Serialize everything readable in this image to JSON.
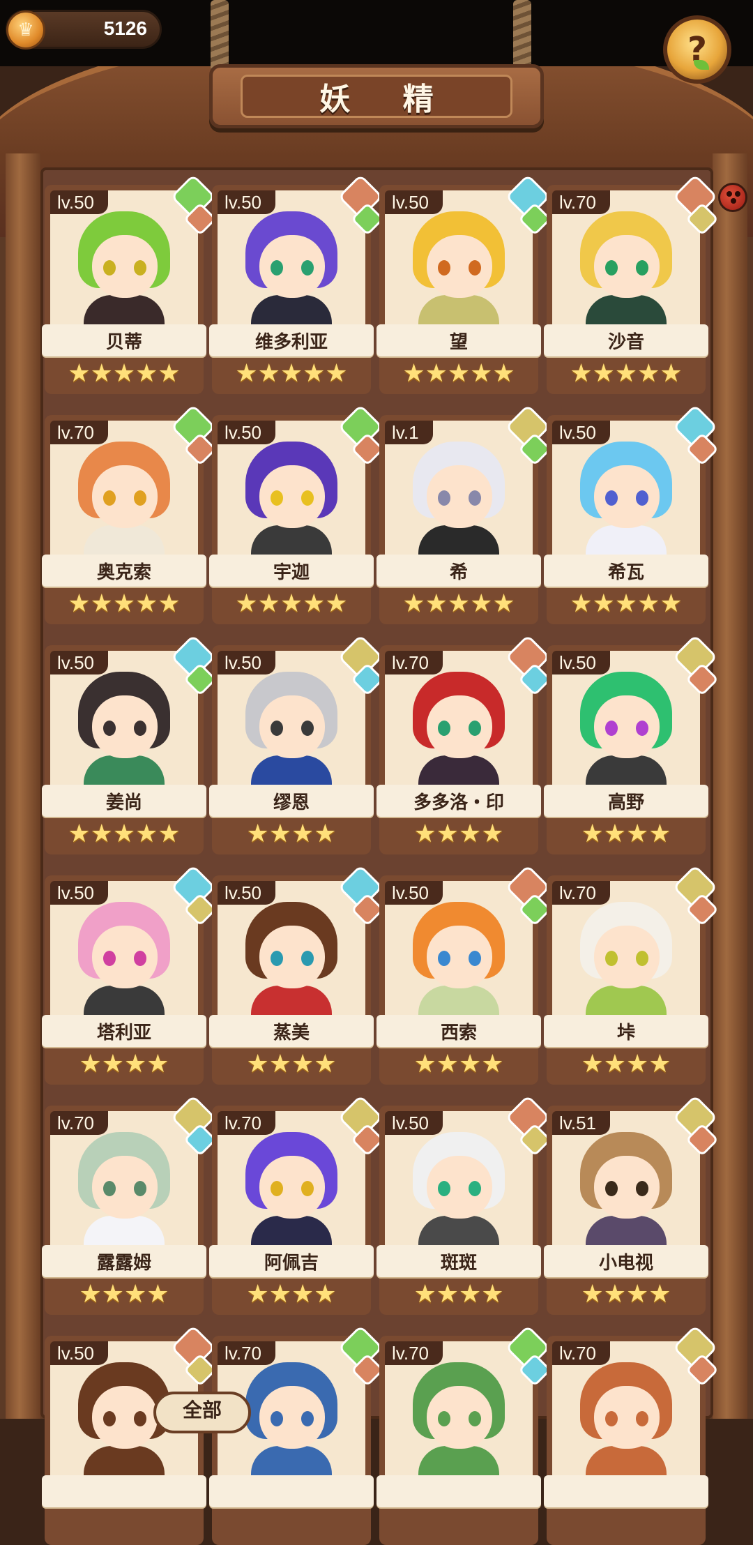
{
  "header": {
    "currency_amount": "5126",
    "title": "妖 精",
    "help_symbol": "?"
  },
  "colors": {
    "green": "#7ccf5a",
    "blue": "#6ccfe0",
    "copper": "#d88460",
    "gold": "#d6c46a"
  },
  "fairies": [
    {
      "level": "lv.50",
      "name": "贝蒂",
      "stars": "★★★★★",
      "hair": "#7ecb3c",
      "body": "#3a2a2a",
      "eye": "#c9b020",
      "elem1": "green",
      "elem2": "copper"
    },
    {
      "level": "lv.50",
      "name": "维多利亚",
      "stars": "★★★★★",
      "hair": "#6a4ad0",
      "body": "#2a2a3a",
      "eye": "#2aa070",
      "elem1": "copper",
      "elem2": "green"
    },
    {
      "level": "lv.50",
      "name": "望",
      "stars": "★★★★★",
      "hair": "#f2c036",
      "body": "#c8c070",
      "eye": "#d06a20",
      "elem1": "blue",
      "elem2": "green"
    },
    {
      "level": "lv.70",
      "name": "沙音",
      "stars": "★★★★★",
      "hair": "#f0c84a",
      "body": "#2a4a3a",
      "eye": "#28a060",
      "elem1": "copper",
      "elem2": "gold"
    },
    {
      "level": "lv.70",
      "name": "奥克索",
      "stars": "★★★★★",
      "hair": "#e8884a",
      "body": "#f0e8d8",
      "eye": "#e0a020",
      "elem1": "green",
      "elem2": "copper"
    },
    {
      "level": "lv.50",
      "name": "宇迦",
      "stars": "★★★★★",
      "hair": "#5a38b8",
      "body": "#3a3a3a",
      "eye": "#e8c020",
      "elem1": "green",
      "elem2": "copper"
    },
    {
      "level": "lv.1",
      "name": "希",
      "stars": "★★★★★",
      "hair": "#e8e8f0",
      "body": "#2a2a2a",
      "eye": "#8888aa",
      "elem1": "gold",
      "elem2": "green"
    },
    {
      "level": "lv.50",
      "name": "希瓦",
      "stars": "★★★★★",
      "hair": "#6cc8f0",
      "body": "#f0f0f8",
      "eye": "#5060d0",
      "elem1": "blue",
      "elem2": "copper"
    },
    {
      "level": "lv.50",
      "name": "姜尚",
      "stars": "★★★★★",
      "hair": "#3a3030",
      "body": "#3a8a5a",
      "eye": "#3a3030",
      "elem1": "blue",
      "elem2": "green"
    },
    {
      "level": "lv.50",
      "name": "缪恩",
      "stars": "★★★★",
      "hair": "#c8c8cc",
      "body": "#2a4aa0",
      "eye": "#3a3a3a",
      "elem1": "gold",
      "elem2": "blue"
    },
    {
      "level": "lv.70",
      "name": "多多洛・印",
      "stars": "★★★★",
      "hair": "#c82a2a",
      "body": "#3a2a3a",
      "eye": "#2aa070",
      "elem1": "copper",
      "elem2": "blue"
    },
    {
      "level": "lv.50",
      "name": "高野",
      "stars": "★★★★",
      "hair": "#2ec070",
      "body": "#3a3a3a",
      "eye": "#b040d0",
      "elem1": "gold",
      "elem2": "copper"
    },
    {
      "level": "lv.50",
      "name": "塔利亚",
      "stars": "★★★★",
      "hair": "#f0a0c8",
      "body": "#3a3a3a",
      "eye": "#d040a0",
      "elem1": "blue",
      "elem2": "gold"
    },
    {
      "level": "lv.50",
      "name": "蒸美",
      "stars": "★★★★",
      "hair": "#6a3a20",
      "body": "#c83030",
      "eye": "#2a9ab0",
      "elem1": "blue",
      "elem2": "copper"
    },
    {
      "level": "lv.50",
      "name": "西索",
      "stars": "★★★★",
      "hair": "#f08a30",
      "body": "#c8d8a0",
      "eye": "#3a88d0",
      "elem1": "copper",
      "elem2": "green"
    },
    {
      "level": "lv.70",
      "name": "垰",
      "stars": "★★★★",
      "hair": "#f4f0e8",
      "body": "#a0c850",
      "eye": "#c0c030",
      "elem1": "gold",
      "elem2": "copper"
    },
    {
      "level": "lv.70",
      "name": "露露姆",
      "stars": "★★★★",
      "hair": "#b8d0b8",
      "body": "#f4f4f8",
      "eye": "#5a8a6a",
      "elem1": "gold",
      "elem2": "blue"
    },
    {
      "level": "lv.70",
      "name": "阿佩吉",
      "stars": "★★★★",
      "hair": "#6a48d8",
      "body": "#2a2a4a",
      "eye": "#e0b020",
      "elem1": "gold",
      "elem2": "copper"
    },
    {
      "level": "lv.50",
      "name": "斑斑",
      "stars": "★★★★",
      "hair": "#f0f0f0",
      "body": "#4a4a4a",
      "eye": "#2ab080",
      "elem1": "copper",
      "elem2": "gold"
    },
    {
      "level": "lv.51",
      "name": "小电视",
      "stars": "★★★★",
      "hair": "#b88a58",
      "body": "#5a4a6a",
      "eye": "#3a2a1a",
      "elem1": "gold",
      "elem2": "copper"
    },
    {
      "level": "lv.50",
      "name": "",
      "stars": "",
      "hair": "#6a3a20",
      "body": "#6a3a20",
      "eye": "#6a3a20",
      "elem1": "copper",
      "elem2": "gold"
    },
    {
      "level": "lv.70",
      "name": "",
      "stars": "",
      "hair": "#3a6ab0",
      "body": "#3a6ab0",
      "eye": "#3a6ab0",
      "elem1": "green",
      "elem2": "copper"
    },
    {
      "level": "lv.70",
      "name": "",
      "stars": "",
      "hair": "#5aa050",
      "body": "#5aa050",
      "eye": "#5aa050",
      "elem1": "green",
      "elem2": "blue"
    },
    {
      "level": "lv.70",
      "name": "",
      "stars": "",
      "hair": "#c86a3a",
      "body": "#c86a3a",
      "eye": "#c86a3a",
      "elem1": "gold",
      "elem2": "copper"
    }
  ],
  "filter_tab": "全部"
}
